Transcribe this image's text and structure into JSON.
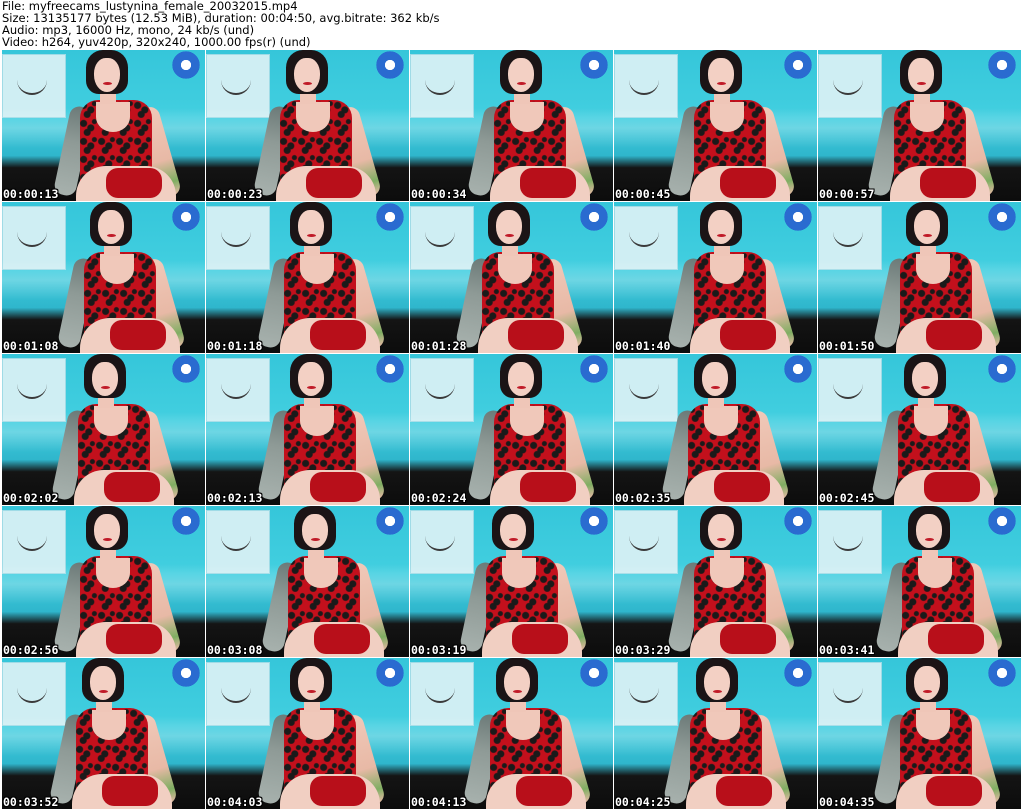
{
  "header": {
    "file": "File: myfreecams_lustynina_female_20032015.mp4",
    "size": "Size: 13135177 bytes (12.53 MiB), duration: 00:04:50, avg.bitrate: 362 kb/s",
    "audio": "Audio: mp3, 16000 Hz, mono, 24 kb/s (und)",
    "video": "Video: h264, yuv420p, 320x240, 1000.00 fps(r) (und)"
  },
  "thumbnails": [
    {
      "timestamp": "00:00:13"
    },
    {
      "timestamp": "00:00:23"
    },
    {
      "timestamp": "00:00:34"
    },
    {
      "timestamp": "00:00:45"
    },
    {
      "timestamp": "00:00:57"
    },
    {
      "timestamp": "00:01:08"
    },
    {
      "timestamp": "00:01:18"
    },
    {
      "timestamp": "00:01:28"
    },
    {
      "timestamp": "00:01:40"
    },
    {
      "timestamp": "00:01:50"
    },
    {
      "timestamp": "00:02:02"
    },
    {
      "timestamp": "00:02:13"
    },
    {
      "timestamp": "00:02:24"
    },
    {
      "timestamp": "00:02:35"
    },
    {
      "timestamp": "00:02:45"
    },
    {
      "timestamp": "00:02:56"
    },
    {
      "timestamp": "00:03:08"
    },
    {
      "timestamp": "00:03:19"
    },
    {
      "timestamp": "00:03:29"
    },
    {
      "timestamp": "00:03:41"
    },
    {
      "timestamp": "00:03:52"
    },
    {
      "timestamp": "00:04:03"
    },
    {
      "timestamp": "00:04:13"
    },
    {
      "timestamp": "00:04:25"
    },
    {
      "timestamp": "00:04:35"
    }
  ],
  "colors": {
    "background_wall": "#42cfe0",
    "dress": "#c3101c",
    "timestamp_text": "#ffffff"
  }
}
